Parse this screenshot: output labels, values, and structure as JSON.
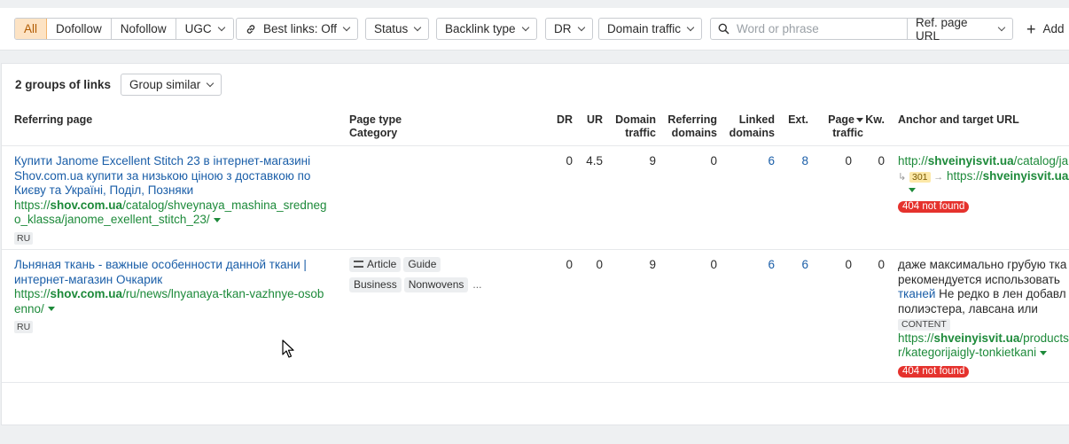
{
  "filters": {
    "segments": [
      "All",
      "Dofollow",
      "Nofollow",
      "UGC"
    ],
    "best_links": "Best links: Off",
    "status": "Status",
    "backlink_type": "Backlink type",
    "dr": "DR",
    "domain_traffic": "Domain traffic",
    "search_placeholder": "Word or phrase",
    "search_scope": "Ref. page URL",
    "add": "Add"
  },
  "summary": {
    "groups": "2 groups of links",
    "group_similar": "Group similar"
  },
  "headers": {
    "referring_page": "Referring page",
    "page_type": "Page type",
    "category": "Category",
    "dr": "DR",
    "ur": "UR",
    "domain_traffic_1": "Domain",
    "domain_traffic_2": "traffic",
    "referring_domains_1": "Referring",
    "referring_domains_2": "domains",
    "linked_domains_1": "Linked",
    "linked_domains_2": "domains",
    "ext": "Ext.",
    "page_traffic_1": "Page",
    "page_traffic_2": "traffic",
    "kw": "Kw.",
    "anchor": "Anchor and target URL"
  },
  "rows": [
    {
      "title_1": "Купити Janome Excellent Stitch 23 в інтернет-магазині",
      "title_2": "Shov.com.ua купити за низькою ціною з доставкою по",
      "title_3": "Києву та Україні, Поділ, Позняки",
      "url_prefix": "https://",
      "url_domain": "shov.com.ua",
      "url_path_1": "/catalog/shveynaya_mashina_sredneg",
      "url_path_2": "o_klassa/janome_exellent_stitch_23/",
      "lang": "RU",
      "dr": "0",
      "ur": "4.5",
      "domain_traffic": "9",
      "referring_domains": "0",
      "linked_domains": "6",
      "ext": "8",
      "page_traffic": "0",
      "kw": "0",
      "target_prefix": "http://",
      "target_domain": "shveinyisvit.ua",
      "target_path": "/catalog/ja",
      "redirect_code": "301",
      "redirect_prefix": "https://",
      "redirect_domain": "shveinyisvit.ua",
      "redirect_path": "/",
      "status": "404 not found"
    },
    {
      "title_1": "Льняная ткань - важные особенности данной ткани |",
      "title_2": "интернет-магазин Очкарик",
      "url_prefix": "https://",
      "url_domain": "shov.com.ua",
      "url_path_1": "/ru/news/lnyanaya-tkan-vazhnye-osob",
      "url_path_2": "enno/",
      "lang": "RU",
      "page_type_1": "Article",
      "page_type_2": "Guide",
      "category_1": "Business",
      "category_2": "Nonwovens",
      "category_more": "...",
      "dr": "0",
      "ur": "0",
      "domain_traffic": "9",
      "referring_domains": "0",
      "linked_domains": "6",
      "ext": "6",
      "page_traffic": "0",
      "kw": "0",
      "anchor_1": "даже максимально грубую тка",
      "anchor_2": "рекомендуется использовать",
      "anchor_link": "тканей",
      "anchor_3": " Не редко в лен добавл",
      "anchor_4": "полиэстера, лавсана или",
      "anchor_badge": "CONTENT",
      "target_prefix": "https://",
      "target_domain": "shveinyisvit.ua",
      "target_path_1": "/products",
      "target_path_2": "r/kategorijaigly-tonkietkani",
      "status": "404 not found"
    }
  ]
}
